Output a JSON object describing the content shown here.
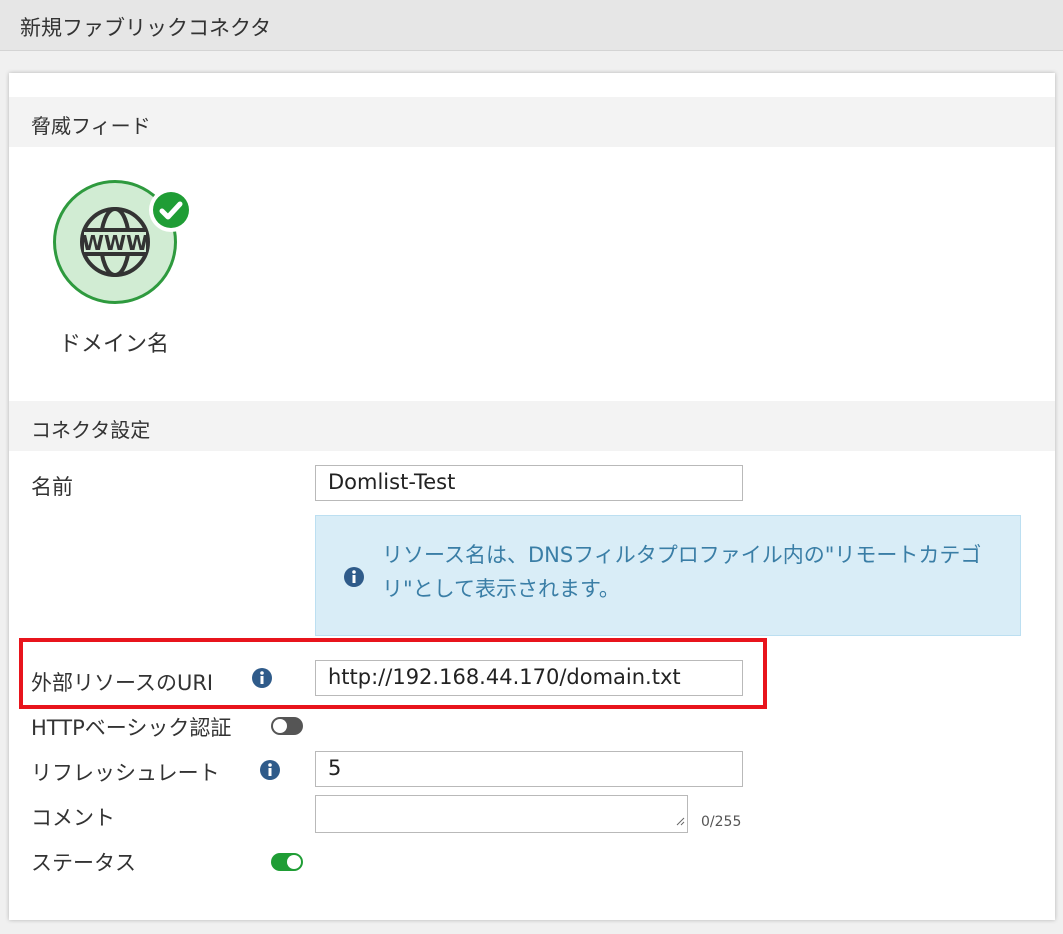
{
  "window": {
    "title": "新規ファブリックコネクタ"
  },
  "threat_feed": {
    "header": "脅威フィード",
    "selected_feed": {
      "label": "ドメイン名",
      "icon": "www-globe-icon",
      "badge_icon": "check-icon"
    }
  },
  "connector_settings": {
    "header": "コネクタ設定",
    "name": {
      "label": "名前",
      "value": "Domlist-Test"
    },
    "info_message": "リソース名は、DNSフィルタプロファイル内の\"リモートカテゴリ\"として表示されます。",
    "uri": {
      "label": "外部リソースのURI",
      "value": "http://192.168.44.170/domain.txt",
      "highlighted": true
    },
    "http_basic_auth": {
      "label": "HTTPベーシック認証",
      "enabled": false
    },
    "refresh_rate": {
      "label": "リフレッシュレート",
      "value": "5"
    },
    "comment": {
      "label": "コメント",
      "value": "",
      "counter": "0/255"
    },
    "status": {
      "label": "ステータス",
      "enabled": true
    }
  },
  "colors": {
    "accent_green": "#1f9d35",
    "info_blue": "#3a7ea6",
    "info_bg": "#d9edf7",
    "highlight_red": "#e8141c",
    "icon_blue": "#2f5b8a"
  }
}
